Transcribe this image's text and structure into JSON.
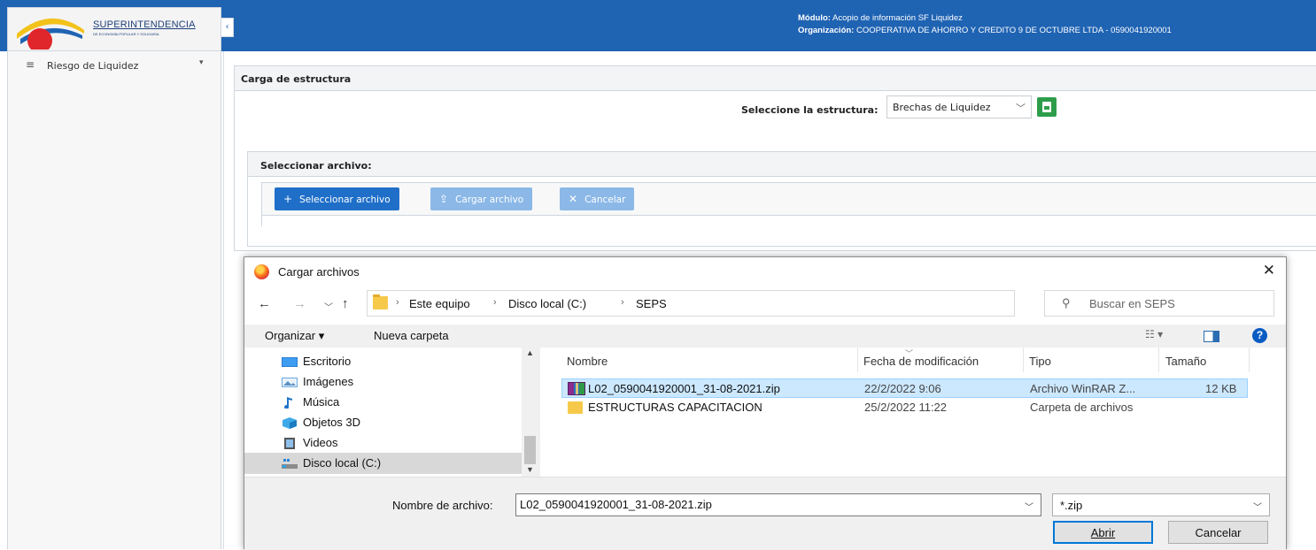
{
  "app": {
    "logo_name": "SUPERINTENDENCIA",
    "logo_sub": "DE ECONOMÍA POPULAR Y SOLIDARIA",
    "header": {
      "module_label": "Módulo:",
      "module_value": " Acopio de información SF Liquidez",
      "org_label": "Organización:",
      "org_value": " COOPERATIVA DE AHORRO Y CREDITO 9 DE OCTUBRE LTDA - 0590041920001"
    },
    "sidebar": {
      "items": [
        {
          "label": "Riesgo de Liquidez",
          "icon": "menu-icon"
        }
      ]
    },
    "upload_panel": {
      "title": "Carga de estructura",
      "structure_label": "Seleccione la estructura:",
      "structure_value": "Brechas de Liquidez",
      "file_section_title": "Seleccionar archivo:",
      "buttons": {
        "select": "Seleccionar archivo",
        "upload": "Cargar archivo",
        "cancel": "Cancelar"
      }
    },
    "colors": {
      "primary": "#1f63b3",
      "button": "#1f6fc9",
      "button_disabled": "#8bb8e7",
      "export_green": "#2e9d4b"
    }
  },
  "dialog": {
    "title": "Cargar archivos",
    "breadcrumb": [
      "Este equipo",
      "Disco local (C:)",
      "SEPS"
    ],
    "search_placeholder": "Buscar en SEPS",
    "toolbar": {
      "organize": "Organizar",
      "new_folder": "Nueva carpeta"
    },
    "nav_tree": [
      {
        "label": "Escritorio",
        "icon": "desktop-icon"
      },
      {
        "label": "Imágenes",
        "icon": "pictures-icon"
      },
      {
        "label": "Música",
        "icon": "music-icon"
      },
      {
        "label": "Objetos 3D",
        "icon": "objects3d-icon"
      },
      {
        "label": "Videos",
        "icon": "videos-icon"
      },
      {
        "label": "Disco local (C:)",
        "icon": "drive-icon",
        "selected": true
      }
    ],
    "columns": [
      "Nombre",
      "Fecha de modificación",
      "Tipo",
      "Tamaño"
    ],
    "files": [
      {
        "name": "L02_0590041920001_31-08-2021.zip",
        "modified": "22/2/2022 9:06",
        "type": "Archivo WinRAR Z...",
        "size": "12 KB",
        "icon": "zip-icon",
        "selected": true
      },
      {
        "name": "ESTRUCTURAS CAPACITACION",
        "modified": "25/2/2022 11:22",
        "type": "Carpeta de archivos",
        "size": "",
        "icon": "folder-icon",
        "selected": false
      }
    ],
    "filename_label": "Nombre de archivo:",
    "filename_value": "L02_0590041920001_31-08-2021.zip",
    "filetype_value": "*.zip",
    "open_button": "Abrir",
    "cancel_button": "Cancelar"
  }
}
